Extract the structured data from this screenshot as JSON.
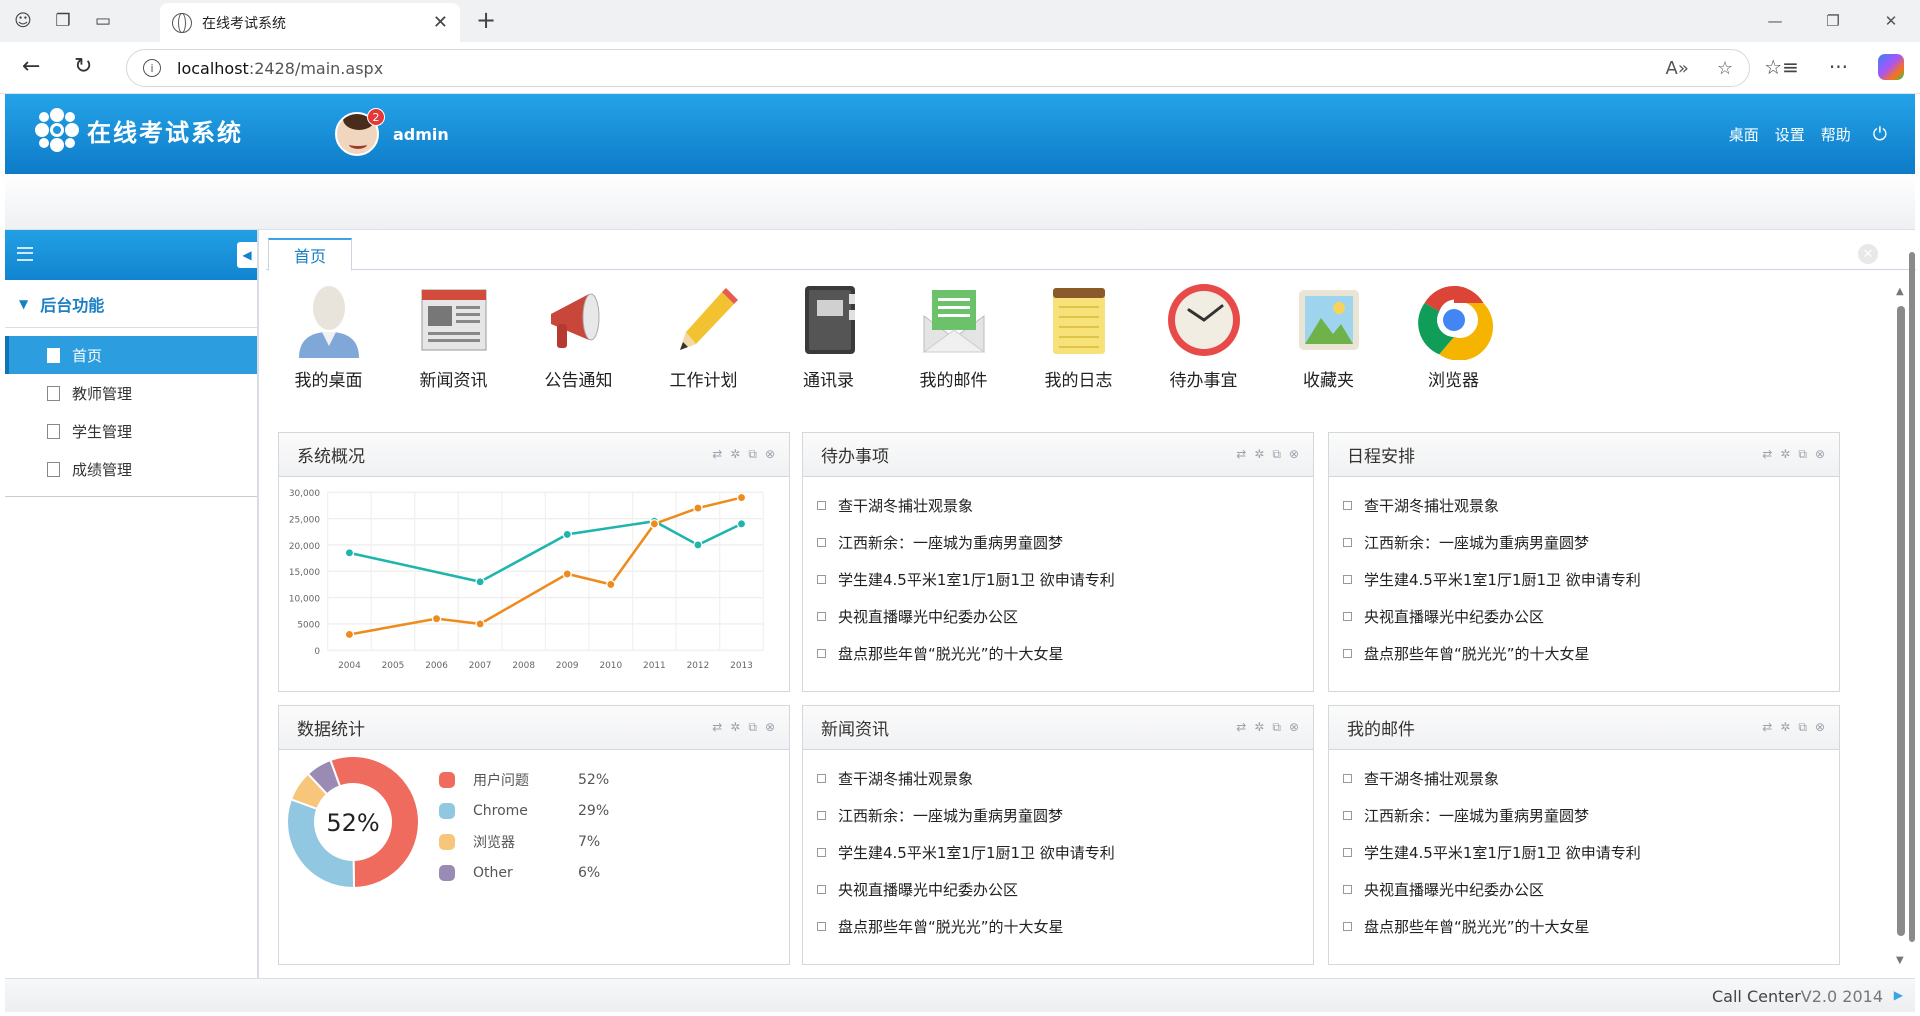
{
  "browser": {
    "tab_title": "在线考试系统",
    "url_host": "localhost",
    "url_path": ":2428/main.aspx"
  },
  "header": {
    "app_title": "在线考试系统",
    "username": "admin",
    "notifications": "2",
    "menu": [
      "桌面",
      "设置",
      "帮助"
    ]
  },
  "sidebar": {
    "section": "后台功能",
    "items": [
      {
        "label": "首页",
        "active": true
      },
      {
        "label": "教师管理"
      },
      {
        "label": "学生管理"
      },
      {
        "label": "成绩管理"
      }
    ]
  },
  "tabs": [
    "首页"
  ],
  "shortcuts": [
    "我的桌面",
    "新闻资讯",
    "公告通知",
    "工作计划",
    "通讯录",
    "我的邮件",
    "我的日志",
    "待办事宜",
    "收藏夹",
    "浏览器"
  ],
  "news_items": [
    "查干湖冬捕壮观景象",
    "江西新余：一座城为重病男童圆梦",
    "学生建4.5平米1室1厅1厨1卫 欲申请专利",
    "央视直播曝光中纪委办公区",
    "盘点那些年曾“脱光光”的十大女星"
  ],
  "panels": {
    "overview": "系统概况",
    "todo": "待办事项",
    "schedule": "日程安排",
    "stats": "数据统计",
    "news": "新闻资讯",
    "mail": "我的邮件"
  },
  "chart_data": [
    {
      "type": "line",
      "x": [
        "2004",
        "2005",
        "2006",
        "2007",
        "2008",
        "2009",
        "2010",
        "2011",
        "2012",
        "2013"
      ],
      "ylim": [
        0,
        30000
      ],
      "yticks": [
        "0",
        "5000",
        "10,000",
        "15,000",
        "20,000",
        "25,000",
        "30,000"
      ],
      "series": [
        {
          "color": "#1fb5ac",
          "values": [
            18500,
            null,
            null,
            13000,
            null,
            22000,
            null,
            24500,
            20000,
            24000
          ]
        },
        {
          "color": "#ee8b1c",
          "values": [
            3000,
            null,
            6000,
            5000,
            null,
            14500,
            12500,
            24000,
            27000,
            29000
          ]
        }
      ]
    },
    {
      "type": "pie",
      "center_label": "52%",
      "slices": [
        {
          "label": "用户问题",
          "value": 52,
          "pct": "52%",
          "color": "#ee6b5e"
        },
        {
          "label": "Chrome",
          "value": 29,
          "pct": "29%",
          "color": "#91c7e0"
        },
        {
          "label": "浏览器",
          "value": 7,
          "pct": "7%",
          "color": "#f7c67a"
        },
        {
          "label": "Other",
          "value": 6,
          "pct": "6%",
          "color": "#9a8bb5"
        }
      ]
    }
  ],
  "footer": {
    "brand": "Call Center",
    "version": "V2.0 2014"
  }
}
